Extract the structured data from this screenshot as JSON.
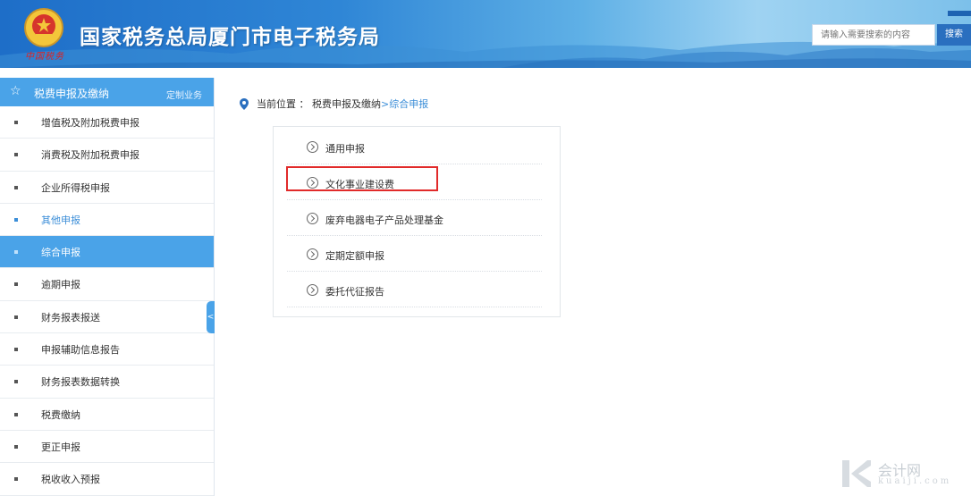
{
  "header": {
    "site_title": "国家税务总局厦门市电子税务局",
    "slogan": "中国税务",
    "search_placeholder": "请输入需要搜索的内容",
    "search_button": "搜索"
  },
  "sidebar": {
    "title": "税费申报及缴纳",
    "custom_label": "定制业务",
    "items": [
      {
        "label": "增值税及附加税费申报",
        "state": "normal"
      },
      {
        "label": "消费税及附加税费申报",
        "state": "normal"
      },
      {
        "label": "企业所得税申报",
        "state": "normal"
      },
      {
        "label": "其他申报",
        "state": "hover"
      },
      {
        "label": "综合申报",
        "state": "active"
      },
      {
        "label": "逾期申报",
        "state": "normal"
      },
      {
        "label": "财务报表报送",
        "state": "normal"
      },
      {
        "label": "申报辅助信息报告",
        "state": "normal"
      },
      {
        "label": "财务报表数据转换",
        "state": "normal"
      },
      {
        "label": "税费缴纳",
        "state": "normal"
      },
      {
        "label": "更正申报",
        "state": "normal"
      },
      {
        "label": "税收收入预报",
        "state": "normal"
      }
    ]
  },
  "breadcrumb": {
    "prefix": "当前位置 ：",
    "parent": "税费申报及缴纳",
    "current": ">综合申报"
  },
  "menu": {
    "items": [
      {
        "label": "通用申报"
      },
      {
        "label": "文化事业建设费"
      },
      {
        "label": "废弃电器电子产品处理基金"
      },
      {
        "label": "定期定额申报"
      },
      {
        "label": "委托代征报告"
      }
    ],
    "highlighted_index": 1
  },
  "watermark": {
    "text": "会计网",
    "sub": "kuaiji.com"
  },
  "colors": {
    "accent": "#4aa3e8",
    "link": "#3b8ed8",
    "highlight_border": "#e12a2a"
  }
}
